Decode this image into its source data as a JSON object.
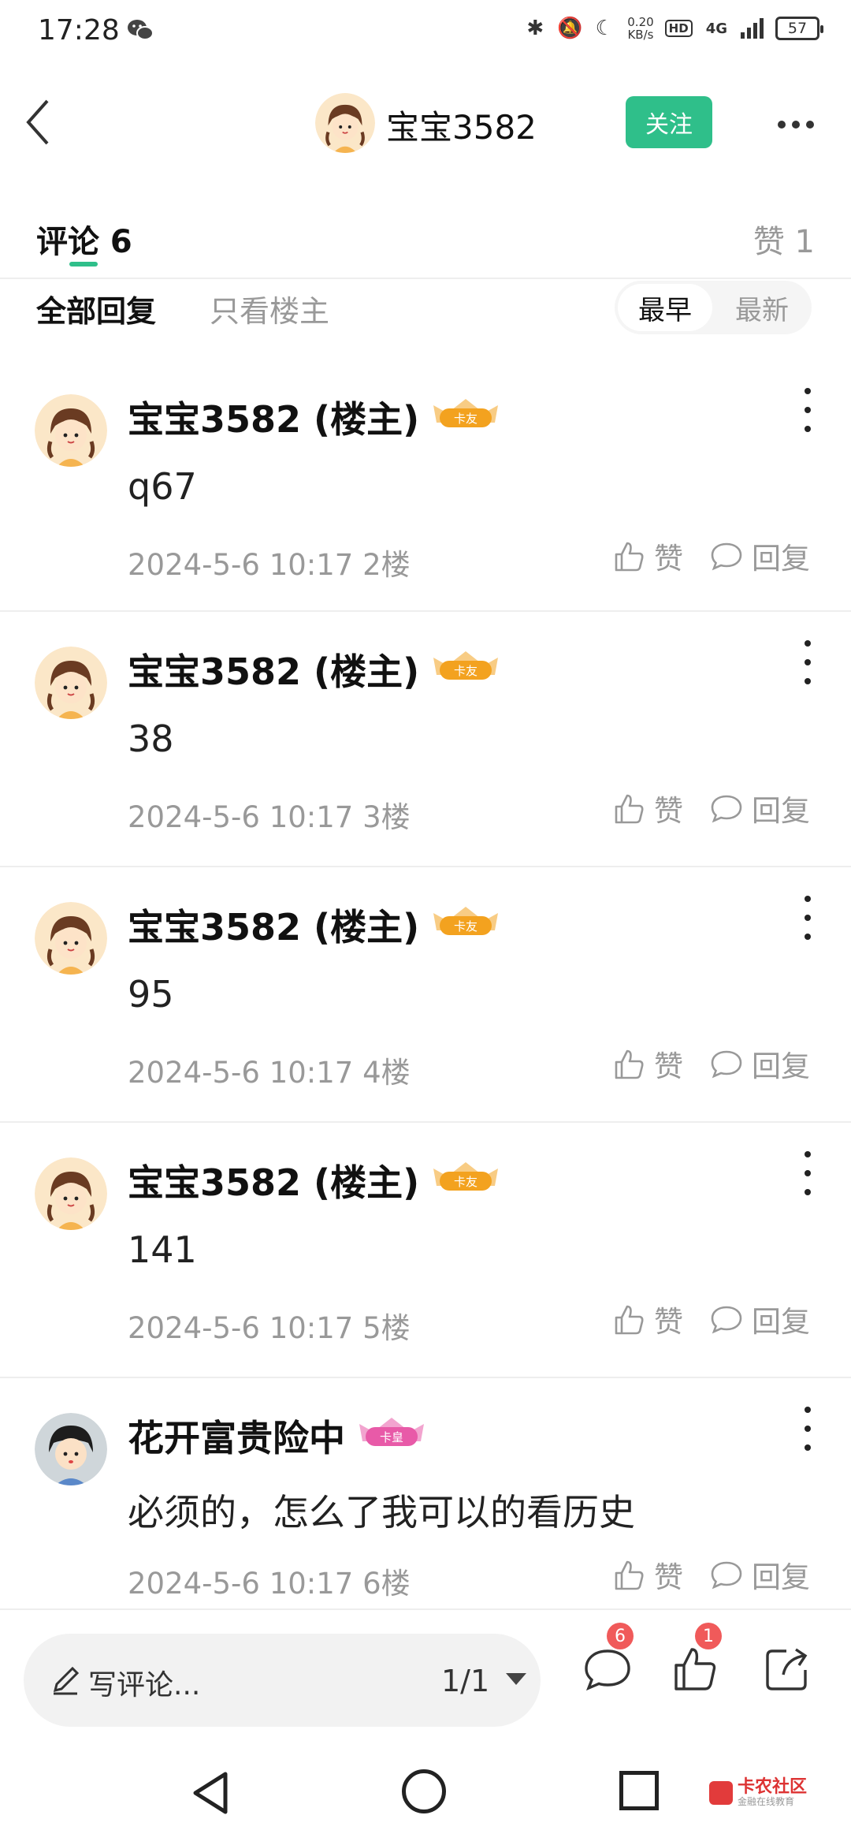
{
  "status_bar": {
    "time": "17:28",
    "net_speed_value": "0.20",
    "net_speed_unit": "KB/s",
    "hd_label": "HD",
    "network_label": "4G",
    "battery": "57",
    "icons": [
      "wechat-icon",
      "bluetooth-icon",
      "mute-icon",
      "moon-icon",
      "signal-icon",
      "battery-icon"
    ]
  },
  "header": {
    "username": "宝宝3582",
    "follow_label": "关注"
  },
  "tabs": {
    "comments_label": "评论 6",
    "likes_label": "赞 1"
  },
  "filters": {
    "all_replies": "全部回复",
    "op_only": "只看楼主",
    "sort_earliest": "最早",
    "sort_newest": "最新"
  },
  "comments": [
    {
      "author": "宝宝3582 (楼主)",
      "badge": "卡友",
      "text": "q67",
      "time": "2024-5-6 10:17",
      "floor": "2楼",
      "like_label": "赞",
      "reply_label": "回复"
    },
    {
      "author": "宝宝3582 (楼主)",
      "badge": "卡友",
      "text": "38",
      "time": "2024-5-6 10:17",
      "floor": "3楼",
      "like_label": "赞",
      "reply_label": "回复"
    },
    {
      "author": "宝宝3582 (楼主)",
      "badge": "卡友",
      "text": "95",
      "time": "2024-5-6 10:17",
      "floor": "4楼",
      "like_label": "赞",
      "reply_label": "回复"
    },
    {
      "author": "宝宝3582 (楼主)",
      "badge": "卡友",
      "text": "141",
      "time": "2024-5-6 10:17",
      "floor": "5楼",
      "like_label": "赞",
      "reply_label": "回复"
    },
    {
      "author": "花开富贵险中",
      "badge": "卡皇",
      "text": "必须的，怎么了我可以的看历史",
      "time": "2024-5-6 10:17",
      "floor": "6楼",
      "like_label": "赞",
      "reply_label": "回复"
    }
  ],
  "bottom_bar": {
    "write_placeholder": "写评论...",
    "page_indicator": "1/1",
    "comment_count": "6",
    "like_count": "1"
  },
  "watermark": {
    "title": "卡农社区",
    "subtitle": "金融在线教育"
  },
  "colors": {
    "accent": "#2fbf8a",
    "badge_red": "#f05a5a",
    "badge_gold": "#f3a21f",
    "badge_pink": "#e85aa8"
  }
}
